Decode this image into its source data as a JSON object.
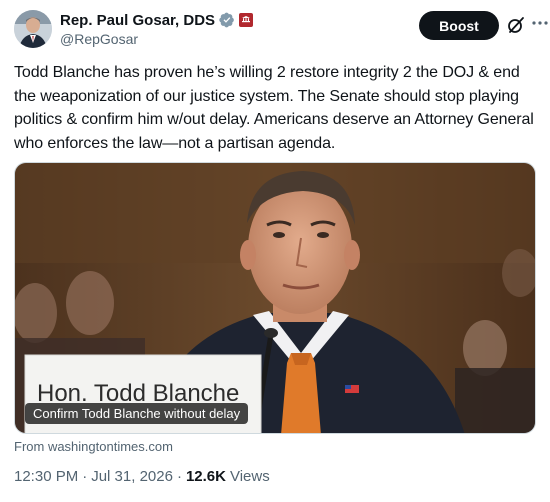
{
  "author": {
    "display_name": "Rep. Paul Gosar, DDS",
    "handle": "@RepGosar"
  },
  "actions": {
    "boost_label": "Boost"
  },
  "tweet": {
    "text": "Todd Blanche has proven he’s willing 2 restore integrity 2 the DOJ & end the weaponization of our justice system. The Senate should stop playing politics & confirm him w/out delay. Americans deserve an Attorney General who enforces the law—not a partisan agenda."
  },
  "media": {
    "caption": "Confirm Todd Blanche without delay",
    "nameplate": "Hon. Todd Blanche",
    "source": "From washingtontimes.com"
  },
  "meta": {
    "time": "12:30 PM",
    "date": "Jul 31, 2026",
    "views_count": "12.6K",
    "views_label": "Views"
  },
  "colors": {
    "accent": "#1d9bf0",
    "boost_bg": "#0f1419",
    "muted": "#536471",
    "gov_badge": "#b1282e"
  }
}
